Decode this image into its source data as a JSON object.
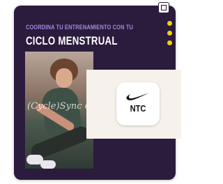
{
  "headline": {
    "line1": "COORDINA TU ENTRENAMIENTO CON TU",
    "line2": "CICLO MENSTRUAL"
  },
  "photo_overlay_text": "(Cycle)Sync on",
  "credit_lines": [
    "",
    ""
  ],
  "app": {
    "name": "NTC",
    "icon": "nike-swoosh-icon"
  },
  "carousel": {
    "dots": 3
  },
  "colors": {
    "card_bg": "#2b1b3c",
    "headline_accent": "#9d8de0",
    "dot": "#f1d10a",
    "panel_bg": "#f6f1ea"
  }
}
